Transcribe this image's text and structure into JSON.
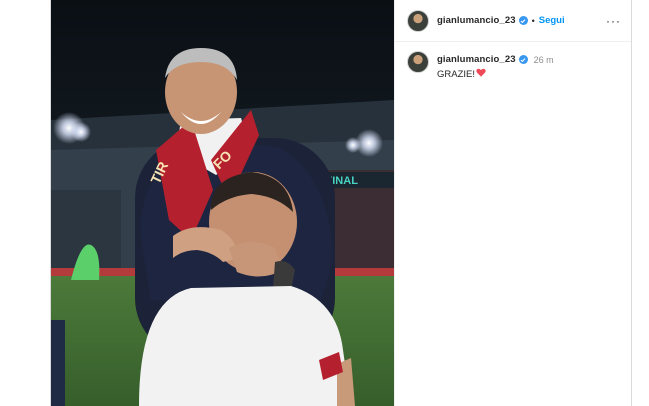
{
  "post": {
    "username": "gianlumancio_23",
    "follow_label": "Segui",
    "separator": "•",
    "more_label": "···",
    "caption": {
      "username": "gianlumancio_23",
      "time": "26 m",
      "text": "GRAZIE!",
      "emoji": "heart-icon"
    },
    "photo": {
      "scarf_text_left": "TIR",
      "scarf_text_right": "FO",
      "banner_text": "NA FINAL"
    }
  },
  "colors": {
    "link_blue": "#0095f6",
    "verified_blue": "#3897f0",
    "heart_red": "#ed4956",
    "text_dark": "#262626",
    "text_gray": "#8e8e8e"
  }
}
